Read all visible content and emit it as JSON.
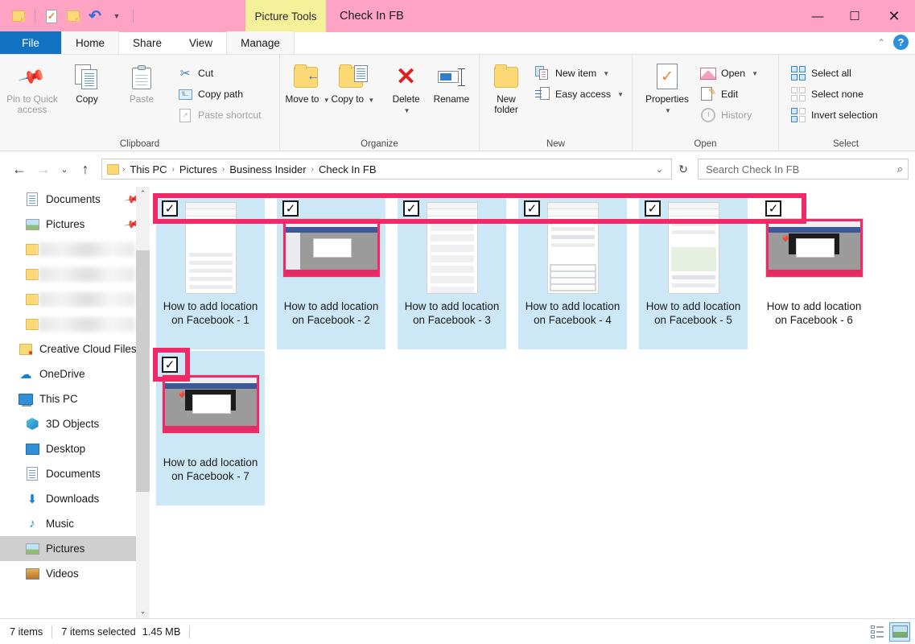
{
  "titlebar": {
    "quick_access": [
      "folder-icon",
      "properties-icon",
      "folder-icon",
      "undo-icon",
      "customize-caret-icon"
    ],
    "contextual_tab": "Picture Tools",
    "window_title": "Check In FB",
    "minimize": "—",
    "maximize": "☐",
    "close": "✕"
  },
  "tabs": {
    "file": "File",
    "items": [
      "Home",
      "Share",
      "View"
    ],
    "manage": "Manage",
    "collapse_caret": "⌃",
    "help": "?"
  },
  "ribbon": {
    "clipboard": {
      "title": "Clipboard",
      "pin": "Pin to Quick access",
      "copy": "Copy",
      "paste": "Paste",
      "cut": "Cut",
      "copy_path": "Copy path",
      "paste_shortcut": "Paste shortcut"
    },
    "organize": {
      "title": "Organize",
      "move_to": "Move to",
      "copy_to": "Copy to",
      "delete": "Delete",
      "rename": "Rename"
    },
    "new": {
      "title": "New",
      "new_folder": "New folder",
      "new_item": "New item",
      "easy_access": "Easy access"
    },
    "open": {
      "title": "Open",
      "properties": "Properties",
      "open": "Open",
      "edit": "Edit",
      "history": "History"
    },
    "select": {
      "title": "Select",
      "select_all": "Select all",
      "select_none": "Select none",
      "invert_selection": "Invert selection"
    }
  },
  "address": {
    "back": "←",
    "forward": "→",
    "recent_caret": "⌄",
    "up": "↑",
    "breadcrumbs": [
      "This PC",
      "Pictures",
      "Business Insider",
      "Check In FB"
    ],
    "separator": "›",
    "dropdown_caret": "⌄",
    "refresh": "↻"
  },
  "search": {
    "placeholder": "Search Check In FB",
    "icon": "⌕"
  },
  "sidebar": {
    "items": [
      {
        "label": "Documents",
        "icon": "document-icon",
        "pinned": true,
        "indent": 1,
        "selected": false,
        "blurred": false
      },
      {
        "label": "Pictures",
        "icon": "picture-icon",
        "pinned": true,
        "indent": 1,
        "selected": false,
        "blurred": false
      },
      {
        "label": "",
        "icon": "folder-icon",
        "pinned": false,
        "indent": 1,
        "selected": false,
        "blurred": true
      },
      {
        "label": "",
        "icon": "folder-icon",
        "pinned": false,
        "indent": 1,
        "selected": false,
        "blurred": true
      },
      {
        "label": "",
        "icon": "folder-icon",
        "pinned": false,
        "indent": 1,
        "selected": false,
        "blurred": true
      },
      {
        "label": "",
        "icon": "folder-icon",
        "pinned": false,
        "indent": 1,
        "selected": false,
        "blurred": true
      },
      {
        "label": "Creative Cloud Files",
        "icon": "creative-cloud-icon",
        "pinned": false,
        "indent": 0,
        "selected": false,
        "blurred": false
      },
      {
        "label": "OneDrive",
        "icon": "onedrive-icon",
        "pinned": false,
        "indent": 0,
        "selected": false,
        "blurred": false
      },
      {
        "label": "This PC",
        "icon": "this-pc-icon",
        "pinned": false,
        "indent": 0,
        "selected": false,
        "blurred": false
      },
      {
        "label": "3D Objects",
        "icon": "3d-objects-icon",
        "pinned": false,
        "indent": 1,
        "selected": false,
        "blurred": false
      },
      {
        "label": "Desktop",
        "icon": "desktop-icon",
        "pinned": false,
        "indent": 1,
        "selected": false,
        "blurred": false
      },
      {
        "label": "Documents",
        "icon": "document-icon",
        "pinned": false,
        "indent": 1,
        "selected": false,
        "blurred": false
      },
      {
        "label": "Downloads",
        "icon": "downloads-icon",
        "pinned": false,
        "indent": 1,
        "selected": false,
        "blurred": false
      },
      {
        "label": "Music",
        "icon": "music-icon",
        "pinned": false,
        "indent": 1,
        "selected": false,
        "blurred": false
      },
      {
        "label": "Pictures",
        "icon": "picture-icon",
        "pinned": false,
        "indent": 1,
        "selected": true,
        "blurred": false
      },
      {
        "label": "Videos",
        "icon": "videos-icon",
        "pinned": false,
        "indent": 1,
        "selected": false,
        "blurred": false
      }
    ],
    "scroll_up": "⌃",
    "scroll_down": "⌄"
  },
  "files": [
    {
      "name": "How to add location on Facebook - 1",
      "checked": true,
      "selected": true,
      "thumb": "phone-create-post"
    },
    {
      "name": "How to add location on Facebook - 2",
      "checked": true,
      "selected": true,
      "thumb": "desktop-facebook"
    },
    {
      "name": "How to add location on Facebook - 3",
      "checked": true,
      "selected": true,
      "thumb": "phone-check-in-list"
    },
    {
      "name": "How to add location on Facebook - 4",
      "checked": true,
      "selected": true,
      "thumb": "phone-keyboard"
    },
    {
      "name": "How to add location on Facebook - 5",
      "checked": true,
      "selected": true,
      "thumb": "phone-map"
    },
    {
      "name": "How to add location on Facebook - 6",
      "checked": true,
      "selected": false,
      "thumb": "desktop-dialog"
    },
    {
      "name": "How to add location on Facebook - 7",
      "checked": true,
      "selected": true,
      "thumb": "desktop-dialog"
    }
  ],
  "checkbox_glyph": "✓",
  "status": {
    "item_count": "7 items",
    "selection": "7 items selected",
    "size": "1.45 MB"
  },
  "view_buttons": {
    "details": "details-view-icon",
    "large_icons": "large-icons-view-icon",
    "active": "large_icons"
  },
  "colors": {
    "titlebar_pink": "#ffa3c4",
    "annotation_pink": "#ee2a69",
    "contextual_tab_yellow": "#f5f09a",
    "file_tab_blue": "#1172c1",
    "selection_blue": "#cce8f7"
  }
}
